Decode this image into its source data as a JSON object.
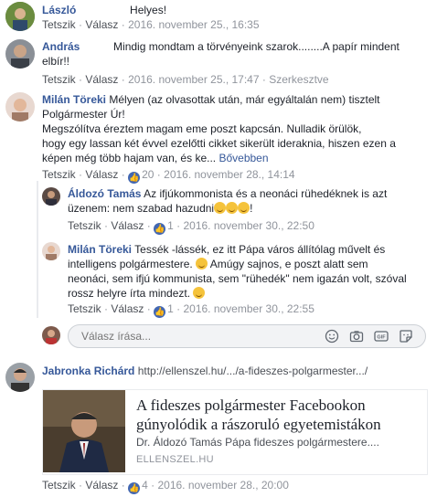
{
  "actions": {
    "like": "Tetszik",
    "reply": "Válasz",
    "sep": " · "
  },
  "comments": [
    {
      "name": "László",
      "text": "Helyes!",
      "time": "2016. november 25., 16:35"
    },
    {
      "name": "András",
      "text": "Mindig mondtam a törvényeink szarok........A papír mindent elbír!!",
      "time": "2016. november 25., 17:47",
      "edited": "Szerkesztve"
    },
    {
      "name": "Milán Töreki",
      "line1": "Mélyen (az olvasottak után, már egyáltalán nem) tisztelt",
      "line2": "Polgármester Úr!",
      "line3": "Megszólítva éreztem magam eme poszt kapcsán. Nulladik örülök,",
      "line4": "hogy egy lassan két évvel ezelőtti cikket sikerült ideraknia, hiszen ezen a",
      "line5": "képen még több hajam van, és ke...",
      "more": "Bővebben",
      "likes": "20",
      "time": "2016. november 28., 14:14"
    }
  ],
  "replies": [
    {
      "name": "Áldozó Tamás",
      "line1": "Az ifjúkommonista és a neonáci rühedéknek is azt",
      "line2a": "üzenem: nem szabad hazudni",
      "line2b": "!",
      "likes": "1",
      "time": "2016. november 30., 22:50"
    },
    {
      "name": "Milán Töreki",
      "line1": "Tessék -lássék, ez itt Pápa város állítólag művelt és",
      "line2a": "intelligens polgármestere.",
      "line2b": "Amúgy sajnos, e poszt alatt sem",
      "line3": "neonáci, sem ifjú kommunista, sem \"rühedék\" nem igazán volt, szóval",
      "line4": "rossz helyre írta mindezt.",
      "likes": "1",
      "time": "2016. november 30., 22:55"
    }
  ],
  "reply_box": {
    "placeholder": "Válasz írása..."
  },
  "last": {
    "name": "Jabronka Richárd",
    "url": "http://ellenszel.hu/.../a-fideszes-polgarmester.../",
    "card_title": "A fideszes polgármester Facebookon gúnyolódik a rászoruló egyetemistákon",
    "card_desc": "Dr. Áldozó Tamás Pápa fideszes polgármestere....",
    "card_domain": "ELLENSZEL.HU",
    "likes": "4",
    "time": "2016. november 28., 20:00"
  },
  "colors": {
    "link": "#365899",
    "meta": "#90949c",
    "like_badge": "#4267b2"
  }
}
